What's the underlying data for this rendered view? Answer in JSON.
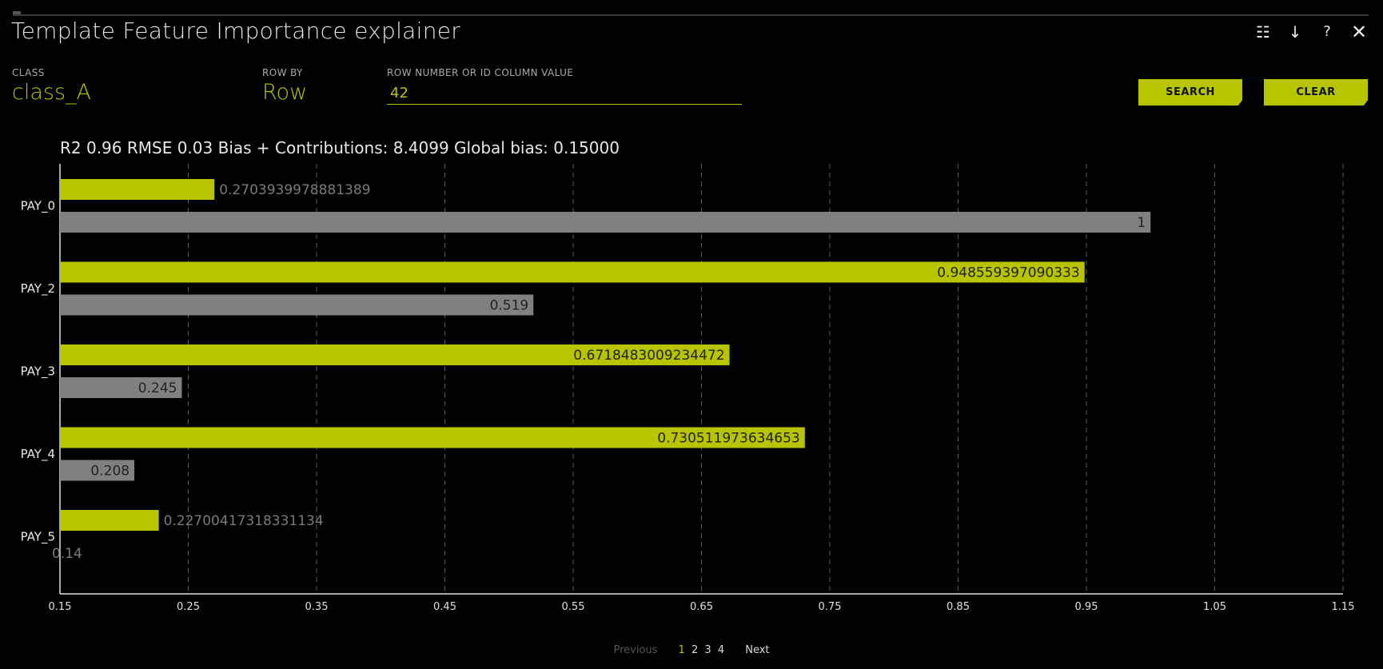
{
  "window": {
    "title": "Template Feature Importance explainer"
  },
  "header_icons": [
    {
      "name": "list-icon",
      "glyph": "☷"
    },
    {
      "name": "download-icon",
      "glyph": "↓"
    },
    {
      "name": "help-icon",
      "glyph": "?"
    },
    {
      "name": "close-icon",
      "glyph": "✕"
    }
  ],
  "controls": {
    "class_label": "CLASS",
    "class_value": "class_A",
    "rowby_label": "ROW BY",
    "rowby_value": "Row",
    "row_label": "ROW NUMBER OR ID COLUMN VALUE",
    "row_value": "42",
    "search_label": "SEARCH",
    "clear_label": "CLEAR"
  },
  "metrics_text": "R2 0.96 RMSE 0.03 Bias + Contributions: 8.4099 Global bias: 0.15000",
  "colors": {
    "accent": "#b7c400",
    "secondary": "#808080",
    "background": "#000000"
  },
  "chart_data": {
    "type": "bar",
    "orientation": "horizontal",
    "categories": [
      "PAY_0",
      "PAY_2",
      "PAY_3",
      "PAY_4",
      "PAY_5"
    ],
    "series": [
      {
        "values": [
          0.2703939978881389,
          0.948559397090333,
          0.6718483009234472,
          0.730511973634653,
          0.22700417318331134
        ],
        "labels": [
          "0.2703939978881389",
          "0.948559397090333",
          "0.6718483009234472",
          "0.730511973634653",
          "0.22700417318331134"
        ],
        "color": "#b7c400"
      },
      {
        "values": [
          1,
          0.519,
          0.245,
          0.208,
          0.14
        ],
        "labels": [
          "1",
          "0.519",
          "0.245",
          "0.208",
          "0.14"
        ],
        "color": "#808080"
      }
    ],
    "xlim": [
      0.15,
      1.15
    ],
    "xticks": [
      "0.15",
      "0.25",
      "0.35",
      "0.45",
      "0.55",
      "0.65",
      "0.75",
      "0.85",
      "0.95",
      "1.05",
      "1.15"
    ],
    "grid": "vertical-dashed",
    "xlabel": "",
    "ylabel": ""
  },
  "pagination": {
    "previous": "Previous",
    "pages": [
      "1",
      "2",
      "3",
      "4"
    ],
    "current": "1",
    "next": "Next"
  }
}
